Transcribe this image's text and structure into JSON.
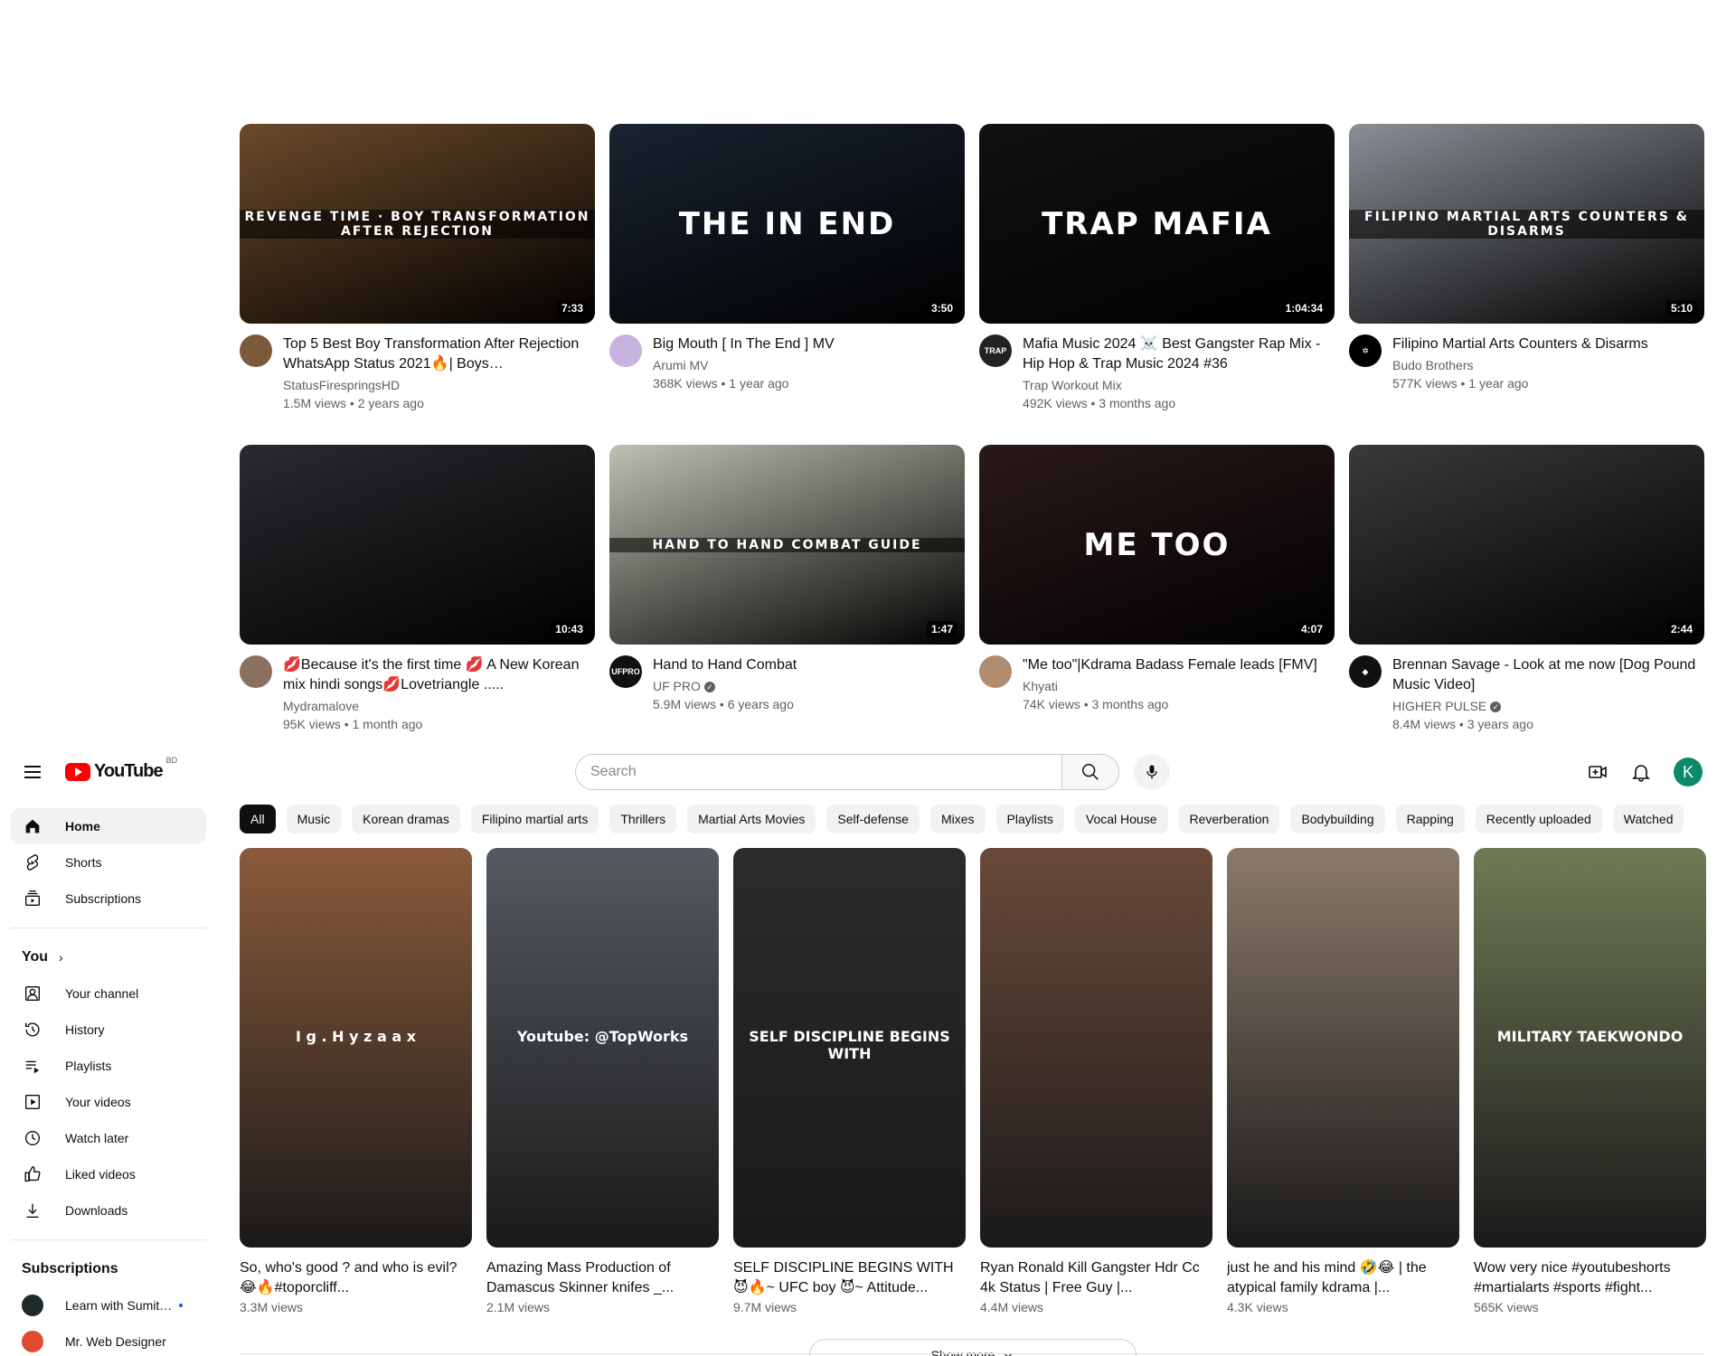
{
  "top_videos": [
    {
      "title": "Top 5 Best Boy Transformation After Rejection WhatsApp Status 2021🔥| Boys…",
      "channel": "StatusFirespringsHD",
      "stats": "1.5M views • 2 years ago",
      "duration": "7:33",
      "thumb_text": "REVENGE TIME · BOY TRANSFORMATION AFTER REJECTION",
      "thumb_bg": "#6b4a2a",
      "avatar_bg": "#7a5a3a",
      "avatar_text": ""
    },
    {
      "title": "Big Mouth [ In The End ] MV",
      "channel": "Arumi MV",
      "stats": "368K views • 1 year ago",
      "duration": "3:50",
      "thumb_text": "THE IN END",
      "thumb_bg": "#1a2330",
      "avatar_bg": "#c6b3e0",
      "avatar_text": ""
    },
    {
      "title": "Mafia Music 2024 ☠️ Best Gangster Rap Mix - Hip Hop & Trap Music 2024 #36",
      "channel": "Trap Workout Mix",
      "stats": "492K views • 3 months ago",
      "duration": "1:04:34",
      "thumb_text": "TRAP MAFIA",
      "thumb_bg": "#111111",
      "avatar_bg": "#222222",
      "avatar_text": "TRAP"
    },
    {
      "title": "Filipino Martial Arts Counters & Disarms",
      "channel": "Budo Brothers",
      "stats": "577K views • 1 year ago",
      "duration": "5:10",
      "thumb_text": "FILIPINO MARTIAL ARTS COUNTERS & DISARMS",
      "thumb_bg": "#8a8f96",
      "avatar_bg": "#000000",
      "avatar_text": "✲"
    },
    {
      "title": "💋Because it's the first time 💋 A New Korean mix hindi songs💋Lovetriangle .....",
      "channel": "Mydramalove",
      "stats": "95K views • 1 month ago",
      "duration": "10:43",
      "thumb_text": "",
      "thumb_bg": "#2a2a2f",
      "avatar_bg": "#8a7060",
      "avatar_text": ""
    },
    {
      "title": "Hand to Hand Combat",
      "channel": "UF PRO",
      "stats": "5.9M views • 6 years ago",
      "duration": "1:47",
      "thumb_text": "HAND TO HAND COMBAT GUIDE",
      "thumb_bg": "#bfbfb2",
      "avatar_bg": "#111111",
      "avatar_text": "UFPRO",
      "verified": true
    },
    {
      "title": "\"Me too\"|Kdrama Badass Female leads [FMV]",
      "channel": "Khyati",
      "stats": "74K views • 3 months ago",
      "duration": "4:07",
      "thumb_text": "ME TOO",
      "thumb_bg": "#2a1a1a",
      "avatar_bg": "#b08c70",
      "avatar_text": ""
    },
    {
      "title": "Brennan Savage - Look at me now [Dog Pound Music Video]",
      "channel": "HIGHER PULSE",
      "stats": "8.4M views • 3 years ago",
      "duration": "2:44",
      "thumb_text": "",
      "thumb_bg": "#3a3a3a",
      "avatar_bg": "#111111",
      "avatar_text": "◆",
      "verified": true
    }
  ],
  "header": {
    "logo_text": "YouTube",
    "country_code": "BD",
    "search_placeholder": "Search",
    "avatar_letter": "K"
  },
  "sidebar": {
    "main": [
      {
        "label": "Home",
        "icon": "home-icon"
      },
      {
        "label": "Shorts",
        "icon": "shorts-icon"
      },
      {
        "label": "Subscriptions",
        "icon": "subscriptions-icon"
      }
    ],
    "you_heading": "You",
    "you_items": [
      {
        "label": "Your channel",
        "icon": "your-channel-icon"
      },
      {
        "label": "History",
        "icon": "history-icon"
      },
      {
        "label": "Playlists",
        "icon": "playlists-icon"
      },
      {
        "label": "Your videos",
        "icon": "your-videos-icon"
      },
      {
        "label": "Watch later",
        "icon": "watch-later-icon"
      },
      {
        "label": "Liked videos",
        "icon": "liked-videos-icon"
      },
      {
        "label": "Downloads",
        "icon": "downloads-icon"
      }
    ],
    "subs_heading": "Subscriptions",
    "subs": [
      {
        "label": "Learn with Sumit…",
        "bg": "#1d2b2b",
        "new": true
      },
      {
        "label": "Mr. Web Designer",
        "bg": "#e04a2f",
        "new": false
      }
    ]
  },
  "chips": [
    "All",
    "Music",
    "Korean dramas",
    "Filipino martial arts",
    "Thrillers",
    "Martial Arts Movies",
    "Self-defense",
    "Mixes",
    "Playlists",
    "Vocal House",
    "Reverberation",
    "Bodybuilding",
    "Rapping",
    "Recently uploaded",
    "Watched"
  ],
  "shorts": [
    {
      "title": "So, who's good ? and who is evil? 😂🔥#toporcliff...",
      "views": "3.3M views",
      "bg": "#8a5a3a",
      "overlay": "I g . H y z a a x"
    },
    {
      "title": "Amazing Mass Production of Damascus Skinner knifes _...",
      "views": "2.1M views",
      "bg": "#555a60",
      "overlay": "Youtube: @TopWorks"
    },
    {
      "title": "SELF DISCIPLINE BEGINS WITH 😈🔥~ UFC boy 😈~ Attitude...",
      "views": "9.7M views",
      "bg": "#2b2b2b",
      "overlay": "SELF DISCIPLINE BEGINS WITH"
    },
    {
      "title": "Ryan Ronald Kill Gangster Hdr Cc 4k Status | Free Guy |...",
      "views": "4.4M views",
      "bg": "#6a4a3a",
      "overlay": ""
    },
    {
      "title": "just he and his mind 🤣😂 | the atypical family kdrama |...",
      "views": "4.3K views",
      "bg": "#8a7a6a",
      "overlay": ""
    },
    {
      "title": "Wow very nice #youtubeshorts #martialarts #sports #fight...",
      "views": "565K views",
      "bg": "#6f7a55",
      "overlay": "MILITARY TAEKWONDO"
    }
  ],
  "show_more": "Show more"
}
